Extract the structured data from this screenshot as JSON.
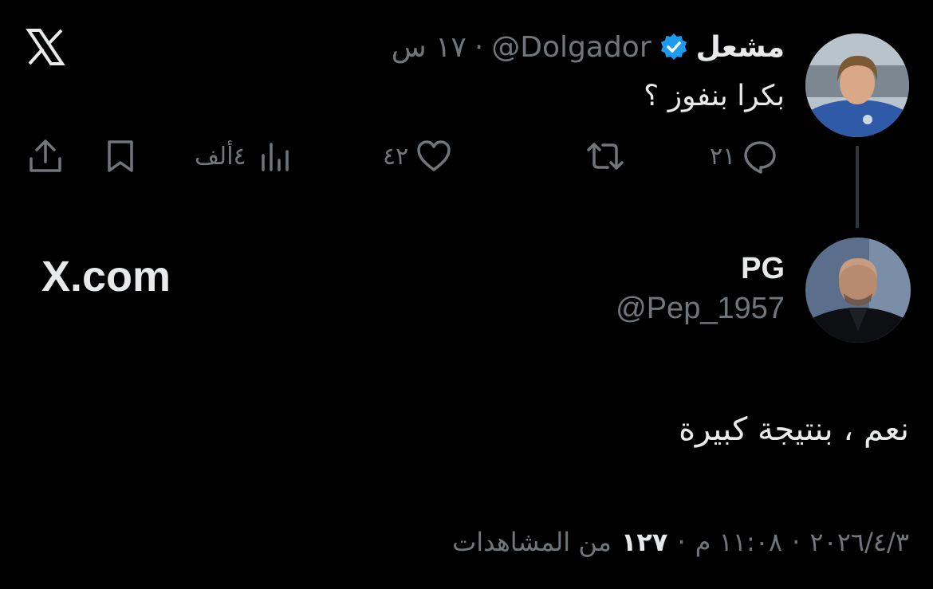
{
  "top_left_logo": "X",
  "first_tweet": {
    "author_name": "مشعل",
    "handle": "@Dolgador",
    "time": "١٧ س",
    "separator": "·",
    "text": "بكرا بنفوز ؟",
    "actions": {
      "replies": "٢١",
      "likes": "٤٢",
      "views": "٤ألف"
    }
  },
  "reply_tweet": {
    "author_name": "PG",
    "handle": "@Pep_1957",
    "text": "نعم ، بنتيجة كبيرة",
    "footer": {
      "date": "٢٠٢٦/٤/٣",
      "sep1": "·",
      "time": "١١:٠٨ م",
      "sep2": "·",
      "views_count": "١٢٧",
      "views_label": "من المشاهدات"
    }
  },
  "site_watermark": "X.com",
  "colors": {
    "background": "#000000",
    "text": "#e7e9ea",
    "muted": "#71767b",
    "verified": "#1d9bf0",
    "thread_line": "#333639"
  },
  "icons": [
    "x-logo-icon",
    "verified-badge-icon",
    "reply-icon",
    "retweet-icon",
    "like-icon",
    "views-icon",
    "bookmark-icon",
    "share-icon"
  ]
}
